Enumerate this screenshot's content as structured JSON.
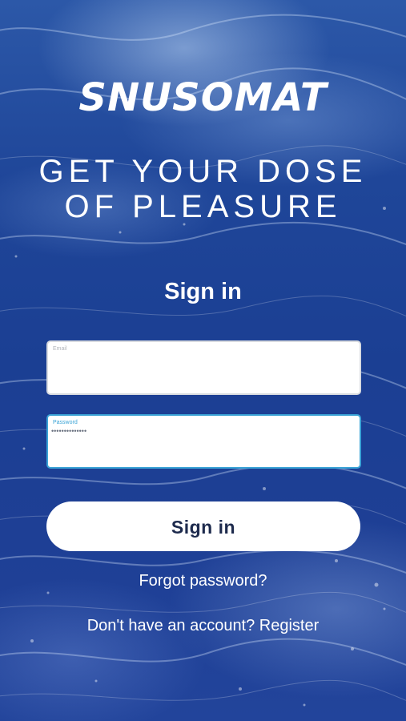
{
  "brand": {
    "logo_text": "SNUSOMAT"
  },
  "tagline": {
    "line1": "GET YOUR DOSE",
    "line2": "OF PLEASURE"
  },
  "form": {
    "title": "Sign in",
    "email": {
      "label": "Email",
      "value": ""
    },
    "password": {
      "label": "Password",
      "value": "••••••••••••••"
    },
    "submit_label": "Sign in"
  },
  "links": {
    "forgot_password": "Forgot password?",
    "register_prompt": "Don't have an account? Register"
  },
  "colors": {
    "background": "#1f4699",
    "button_text": "#1d2a4d",
    "focus_border": "#3aa3d6"
  }
}
